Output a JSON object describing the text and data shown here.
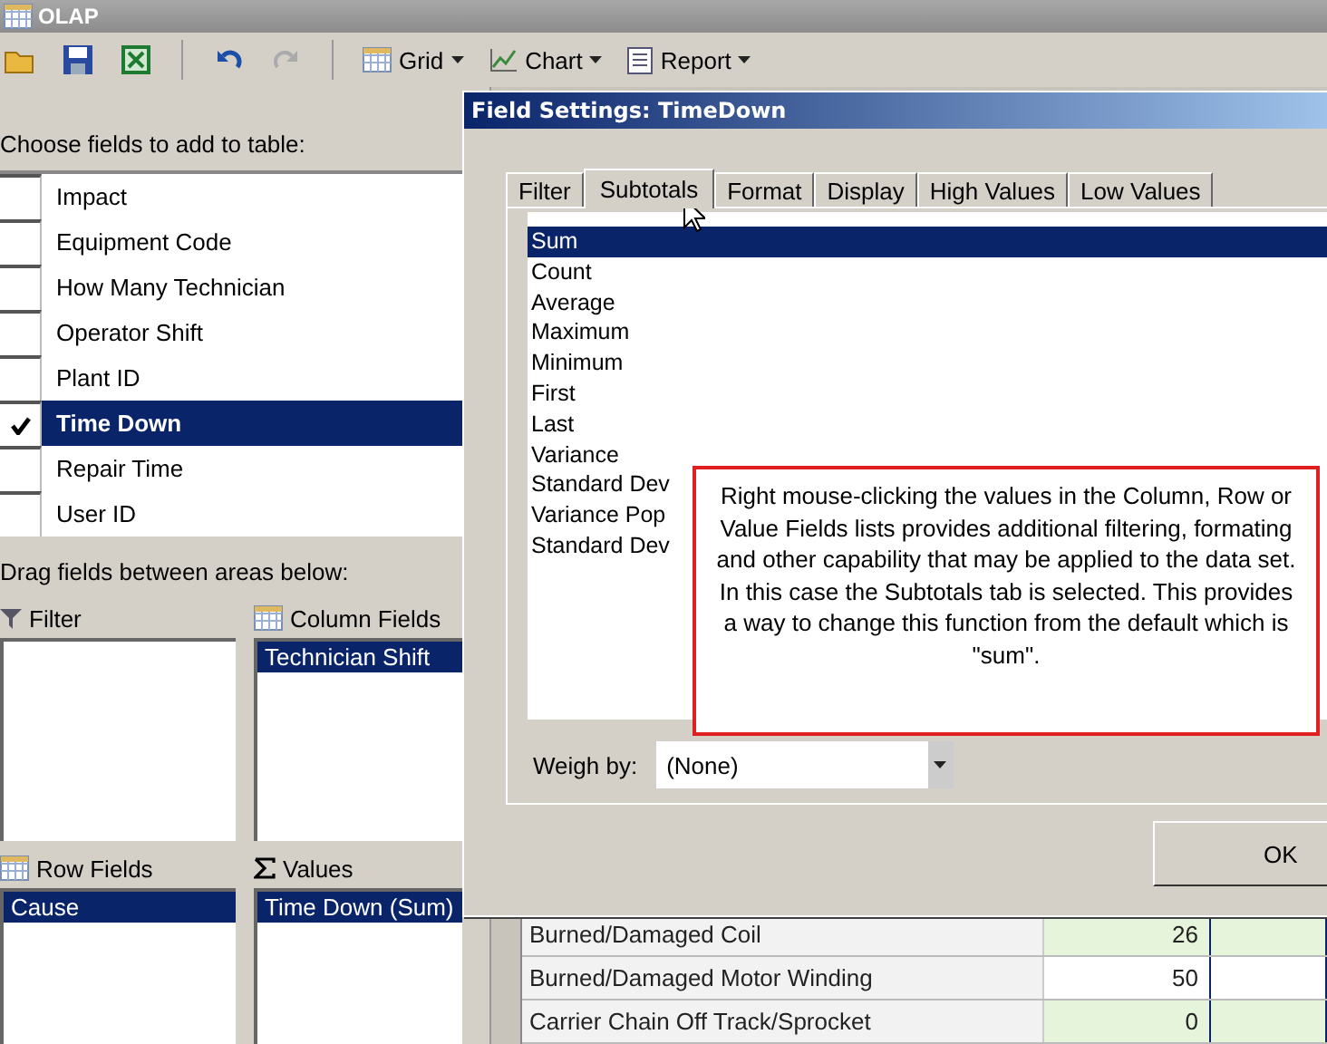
{
  "window": {
    "title": "OLAP"
  },
  "toolbar": {
    "menus": [
      {
        "label": "Grid",
        "kind": "grid"
      },
      {
        "label": "Chart",
        "kind": "chart"
      },
      {
        "label": "Report",
        "kind": "report"
      }
    ]
  },
  "field_list": {
    "heading": "Choose fields to add to table:",
    "fields": [
      {
        "name": "Impact",
        "checked": false,
        "selected": false
      },
      {
        "name": "Equipment Code",
        "checked": false,
        "selected": false
      },
      {
        "name": "How Many Technician",
        "checked": false,
        "selected": false
      },
      {
        "name": "Operator Shift",
        "checked": false,
        "selected": false
      },
      {
        "name": "Plant ID",
        "checked": false,
        "selected": false
      },
      {
        "name": "Time Down",
        "checked": true,
        "selected": true
      },
      {
        "name": "Repair Time",
        "checked": false,
        "selected": false
      },
      {
        "name": "User ID",
        "checked": false,
        "selected": false
      }
    ]
  },
  "areas": {
    "heading": "Drag fields between areas below:",
    "zones": [
      {
        "title": "Filter",
        "kind": "filter"
      },
      {
        "title": "Column Fields",
        "kind": "grid",
        "items": [
          {
            "label": "Technician Shift",
            "selected": true
          }
        ]
      },
      {
        "title": "Row Fields",
        "kind": "grid",
        "items": [
          {
            "label": "Cause",
            "selected": true
          }
        ]
      },
      {
        "title": "Values",
        "kind": "sigma",
        "items": [
          {
            "label": "Time Down (Sum)",
            "selected": true
          }
        ]
      }
    ]
  },
  "dialog": {
    "title": "Field Settings: TimeDown",
    "tabs": [
      {
        "label": "Filter",
        "selected": false
      },
      {
        "label": "Subtotals",
        "selected": true
      },
      {
        "label": "Format",
        "selected": false
      },
      {
        "label": "Display",
        "selected": false
      },
      {
        "label": "High Values",
        "selected": false
      },
      {
        "label": "Low Values",
        "selected": false
      }
    ],
    "functions": [
      {
        "label": "Sum",
        "selected": true
      },
      {
        "label": "Count",
        "selected": false
      },
      {
        "label": "Average",
        "selected": false
      },
      {
        "label": "Maximum",
        "selected": false
      },
      {
        "label": "Minimum",
        "selected": false
      },
      {
        "label": "First",
        "selected": false
      },
      {
        "label": "Last",
        "selected": false
      },
      {
        "label": "Variance",
        "selected": false
      },
      {
        "label": "Standard Dev",
        "selected": false
      },
      {
        "label": "Variance Pop",
        "selected": false
      },
      {
        "label": "Standard Dev",
        "selected": false
      }
    ],
    "weigh_by": {
      "label": "Weigh by:",
      "value": "(None)"
    },
    "ok_button": "OK"
  },
  "callout": {
    "text": "Right mouse-clicking the values in the Column, Row or Value Fields lists provides additional filtering, formating and other capability that may be applied to the data set. In this case the Subtotals tab is selected. This provides a way to change this function from the default which is \"sum\"."
  },
  "table": {
    "rows": [
      {
        "label": "Burned/Damaged Coil",
        "value": "26"
      },
      {
        "label": "Burned/Damaged Motor Winding",
        "value": "50"
      },
      {
        "label": "Carrier Chain Off Track/Sprocket",
        "value": "0"
      }
    ]
  }
}
